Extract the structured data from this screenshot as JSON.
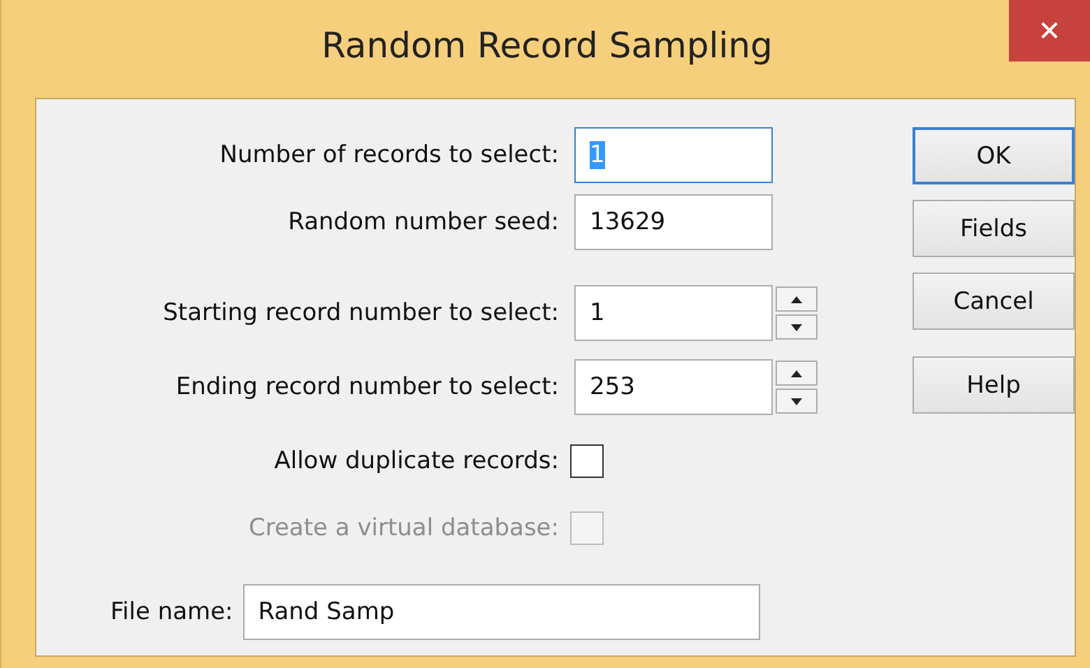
{
  "window": {
    "title": "Random Record Sampling",
    "close": "✕"
  },
  "fields": [
    {
      "label": "Number of records to select:",
      "value": "1",
      "kind": "text",
      "text_selected": true
    },
    {
      "label": "Random number seed:",
      "value": "13629",
      "kind": "text",
      "text_selected": false
    },
    {
      "label": "Starting record number to select:",
      "value": "1",
      "kind": "spin",
      "text_selected": false
    },
    {
      "label": "Ending record number to select:",
      "value": "253",
      "kind": "spin",
      "text_selected": false
    }
  ],
  "checkboxes": [
    {
      "label": "Allow duplicate records:",
      "checked": false,
      "disabled": false
    },
    {
      "label": "Create a virtual database:",
      "checked": false,
      "disabled": true
    }
  ],
  "file_name": {
    "label": "File name:",
    "value": "Rand Samp"
  },
  "buttons": [
    {
      "label": "OK",
      "default": true
    },
    {
      "label": "Fields",
      "default": false
    },
    {
      "label": "Cancel",
      "default": false
    },
    {
      "label": "Help",
      "default": false
    }
  ]
}
